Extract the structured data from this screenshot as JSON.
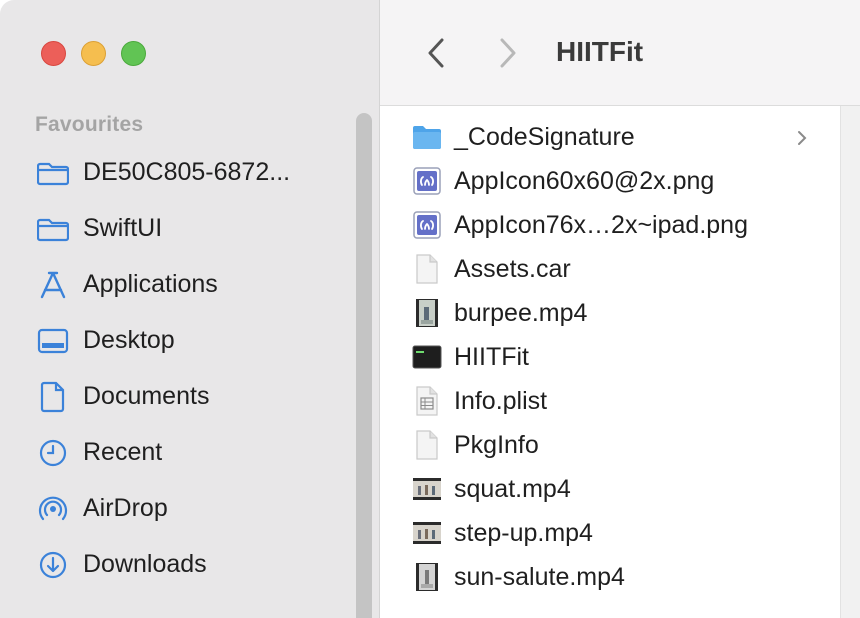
{
  "window": {
    "title": "HIITFit"
  },
  "sidebar": {
    "section_title": "Favourites",
    "items": [
      {
        "label": "DE50C805-6872...",
        "icon": "folder-icon"
      },
      {
        "label": "SwiftUI",
        "icon": "folder-icon"
      },
      {
        "label": "Applications",
        "icon": "applications-icon"
      },
      {
        "label": "Desktop",
        "icon": "desktop-icon"
      },
      {
        "label": "Documents",
        "icon": "document-icon"
      },
      {
        "label": "Recent",
        "icon": "clock-icon"
      },
      {
        "label": "AirDrop",
        "icon": "airdrop-icon"
      },
      {
        "label": "Downloads",
        "icon": "download-icon"
      }
    ]
  },
  "files": [
    {
      "name": "_CodeSignature",
      "icon": "folder-icon"
    },
    {
      "name": "AppIcon60x60@2x.png",
      "icon": "image-icon"
    },
    {
      "name": "AppIcon76x…2x~ipad.png",
      "icon": "image-icon"
    },
    {
      "name": "Assets.car",
      "icon": "blank-file-icon"
    },
    {
      "name": "burpee.mp4",
      "icon": "video-icon"
    },
    {
      "name": "HIITFit",
      "icon": "executable-icon"
    },
    {
      "name": "Info.plist",
      "icon": "plist-icon"
    },
    {
      "name": "PkgInfo",
      "icon": "blank-file-icon"
    },
    {
      "name": "squat.mp4",
      "icon": "video-icon"
    },
    {
      "name": "step-up.mp4",
      "icon": "video-icon"
    },
    {
      "name": "sun-salute.mp4",
      "icon": "video-icon"
    }
  ],
  "colors": {
    "accent": "#3b82d9",
    "close": "#ec5f59",
    "minimize": "#f5be4f",
    "zoom": "#61c454",
    "sidebar_bg": "#e8e7e8"
  }
}
